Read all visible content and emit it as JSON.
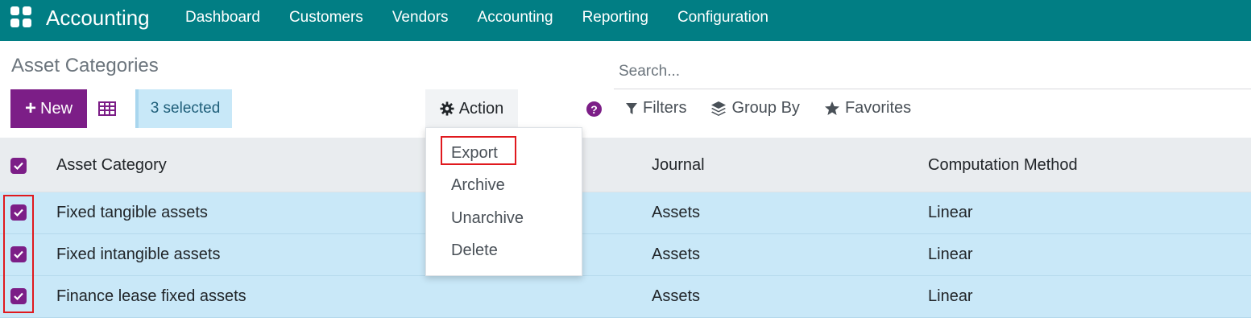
{
  "navbar": {
    "brand": "Accounting",
    "menu": [
      "Dashboard",
      "Customers",
      "Vendors",
      "Accounting",
      "Reporting",
      "Configuration"
    ]
  },
  "control": {
    "title": "Asset Categories",
    "search_placeholder": "Search...",
    "new_label": "New",
    "selected_label": "3 selected",
    "action_label": "Action",
    "help_label": "?",
    "filters_label": "Filters",
    "group_by_label": "Group By",
    "favorites_label": "Favorites"
  },
  "action_menu": [
    "Export",
    "Archive",
    "Unarchive",
    "Delete"
  ],
  "table": {
    "headers": [
      "Asset Category",
      "Journal",
      "Computation Method"
    ],
    "rows": [
      {
        "category": "Fixed tangible assets",
        "journal": "Assets",
        "method": "Linear"
      },
      {
        "category": "Fixed intangible assets",
        "journal": "Assets",
        "method": "Linear"
      },
      {
        "category": "Finance lease fixed assets",
        "journal": "Assets",
        "method": "Linear"
      }
    ]
  },
  "colors": {
    "navbar": "#017e84",
    "primary": "#7c1e87",
    "selected_row": "#c9e8f8",
    "highlight_outline": "#e0191e"
  }
}
